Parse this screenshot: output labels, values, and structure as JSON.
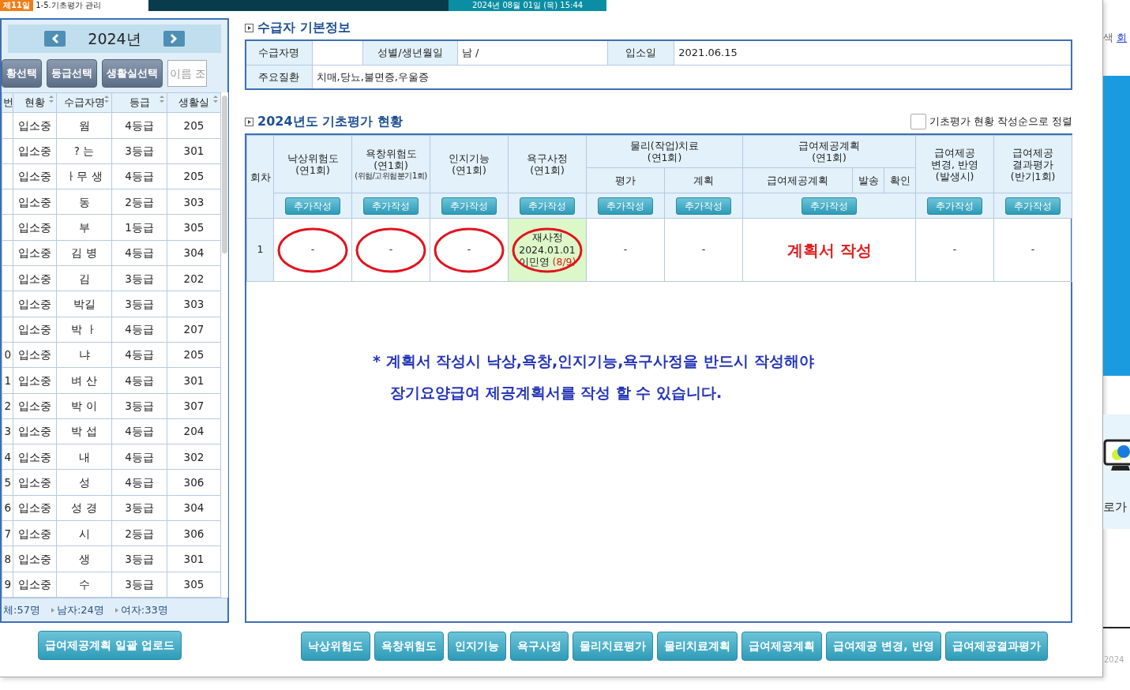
{
  "top_bar": {
    "badge": "제11일",
    "title": "1-5.기초평가 관리",
    "datetime": "2024년 08월 01일 (목) 15:44"
  },
  "left_panel": {
    "year": "2024년",
    "filters": [
      "황선택",
      "등급선택",
      "생활실선택"
    ],
    "search": {
      "placeholder": "이름 조"
    },
    "columns": [
      {
        "label": "번",
        "sortable": false
      },
      {
        "label": "현황",
        "sortable": true
      },
      {
        "label": "수급자명",
        "sortable": true
      },
      {
        "label": "등급",
        "sortable": true
      },
      {
        "label": "생활실",
        "sortable": true
      }
    ],
    "rows": [
      [
        "",
        "입소중",
        "웜",
        "4등급",
        "205"
      ],
      [
        "",
        "입소중",
        "? 는",
        "3등급",
        "301"
      ],
      [
        "",
        "입소중",
        "ㅏ무 생",
        "4등급",
        "205"
      ],
      [
        "",
        "입소중",
        "동",
        "2등급",
        "303"
      ],
      [
        "",
        "입소중",
        "부",
        "1등급",
        "305"
      ],
      [
        "",
        "입소중",
        "김 병",
        "4등급",
        "304"
      ],
      [
        "",
        "입소중",
        "김",
        "3등급",
        "202"
      ],
      [
        "",
        "입소중",
        "박길",
        "3등급",
        "303"
      ],
      [
        "",
        "입소중",
        "박 ㅏ",
        "4등급",
        "207"
      ],
      [
        "0",
        "입소중",
        "냐",
        "4등급",
        "205"
      ],
      [
        "1",
        "입소중",
        "벼 산",
        "4등급",
        "301"
      ],
      [
        "2",
        "입소중",
        "박 이",
        "3등급",
        "307"
      ],
      [
        "3",
        "입소중",
        "박 섭",
        "4등급",
        "204"
      ],
      [
        "4",
        "입소중",
        "내",
        "4등급",
        "302"
      ],
      [
        "5",
        "입소중",
        "성",
        "4등급",
        "306"
      ],
      [
        "6",
        "입소중",
        "성 경",
        "3등급",
        "304"
      ],
      [
        "7",
        "입소중",
        "시",
        "2등급",
        "306"
      ],
      [
        "8",
        "입소중",
        "생",
        "3등급",
        "301"
      ],
      [
        "9",
        "입소중",
        "수",
        "3등급",
        "305"
      ]
    ],
    "summary": [
      "체:57명",
      "남자:24명",
      "여자:33명"
    ],
    "upload_button": "급여제공계획 일괄 업로드"
  },
  "basic_info": {
    "title": "수급자 기본정보",
    "fields": [
      {
        "label": "수급자명"
      },
      {
        "label": "성별/생년월일",
        "value": "남 /"
      },
      {
        "label": "입소일",
        "value": "2021.06.15"
      },
      {
        "label": "주요질환",
        "value": "치매,당뇨,불면증,우울증"
      }
    ]
  },
  "assessment": {
    "title": "2024년도 기초평가 현황",
    "sort_option": {
      "label": "기초평가 현황 작성순으로 정렬",
      "checked": false
    },
    "round_header": "회차",
    "groups": [
      {
        "label": "낙상위험도\n(연1회)"
      },
      {
        "label": "욕창위험도\n(연1회)",
        "note": "(위험/고위험분기1회)"
      },
      {
        "label": "인지기능\n(연1회)"
      },
      {
        "label": "욕구사정\n(연1회)"
      },
      {
        "label": "물리(작업)치료\n(연1회)",
        "subs": [
          "평가",
          "계획"
        ]
      },
      {
        "label": "급여제공계획\n(연1회)",
        "subs": [
          "급여제공계획",
          "발송",
          "확인"
        ]
      },
      {
        "label": "급여제공\n변경, 반영\n(발생시)"
      },
      {
        "label": "급여제공\n결과평가\n(반기1회)"
      }
    ],
    "add_buttons": [
      "추가작성",
      "추가작성",
      "추가작성",
      "추가작성",
      "추가작성",
      "추가작성",
      "추가작성",
      "추가작성",
      "추가작성"
    ],
    "rows": [
      {
        "round": "1",
        "cells": [
          {
            "kind": "text",
            "text": "-",
            "marked": true
          },
          {
            "kind": "text",
            "text": "-",
            "marked": true
          },
          {
            "kind": "text",
            "text": "-",
            "marked": true
          },
          {
            "kind": "done",
            "lines": [
              "재사정",
              "2024.01.01"
            ],
            "author": "이민영",
            "score": "(8/9)",
            "marked": true
          },
          {
            "kind": "text",
            "text": "-",
            "marked": false
          },
          {
            "kind": "text",
            "text": "-",
            "marked": false
          },
          {
            "kind": "alert",
            "text": "계획서 작성",
            "marked": false
          },
          {
            "kind": "text",
            "text": "-",
            "marked": false
          },
          {
            "kind": "text",
            "text": "-",
            "marked": false
          }
        ]
      }
    ],
    "notice": [
      "* 계획서 작성시 낙상,욕창,인지기능,욕구사정을 반드시 작성해야",
      "장기요양급여 제공계획서를 작성 할 수 있습니다."
    ]
  },
  "bottom_buttons": [
    "낙상위험도",
    "욕창위험도",
    "인지기능",
    "욕구사정",
    "물리치료평가",
    "물리치료계획",
    "급여제공계획",
    "급여제공 변경, 반영",
    "급여제공결과평가"
  ],
  "background_page": {
    "texts": [
      "색",
      "회"
    ],
    "caption": "로가",
    "year": "2024"
  }
}
